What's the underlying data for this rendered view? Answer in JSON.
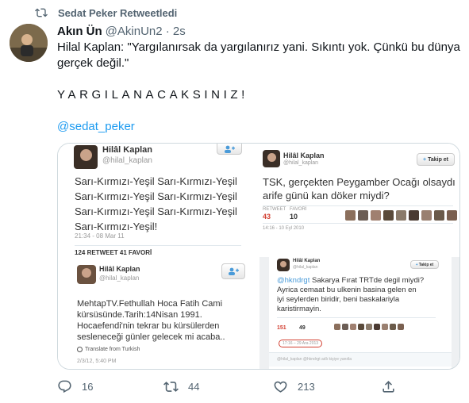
{
  "retweet": {
    "label": "Sedat Peker Retweetledi",
    "icon": "retweet-icon"
  },
  "author": {
    "name": "Akın Ün",
    "handle": "@AkinUn2 · 2s"
  },
  "tweet": {
    "text": "Hilal Kaplan: \"Yargılanırsak da yargılanırız yani. Sıkıntı yok. Çünkü bu dünya gerçek değil.\"",
    "shout": "YARGILANACAKSINIZ!",
    "mention": "@sedat_peker"
  },
  "media": {
    "img1": {
      "name": "Hilâl Kaplan",
      "handle": "@hilal_kaplan",
      "lines": [
        "Sarı-Kırmızı-Yeşil Sarı-Kırmızı-Yeşil",
        "Sarı-Kırmızı-Yeşil Sarı-Kırmızı-Yeşil",
        "Sarı-Kırmızı-Yeşil Sarı-Kırmızı-Yeşil",
        "Sarı-Kırmızı-Yeşil!"
      ],
      "time": "21:34 - 08 Mar 11",
      "stats": "124 RETWEET   41 FAVORİ"
    },
    "img2": {
      "name": "Hilâl Kaplan",
      "handle": "@hilal_kaplan",
      "follow": "Takip et",
      "lines": [
        "TSK, gerçekten Peygamber Ocağı olsaydı",
        "arife günü kan döker miydi?"
      ],
      "rt_label": "RETWEET",
      "rt_value": "43",
      "fav_label": "FAVORİ",
      "fav_value": "10",
      "time": "14:16 - 10 Eyl 2010"
    },
    "img3": {
      "name": "Hilâl Kaplan",
      "handle": "@hilal_kaplan",
      "lines": [
        "MehtapTV.Fethullah Hoca Fatih Cami",
        "kürsüsünde.Tarih:14Nisan 1991.",
        "Hocaefendi'nin tekrar bu kürsülerden",
        "sesleneceği günler gelecek mi acaba.."
      ],
      "translate": "Translate from Turkish",
      "time": "2/3/12, 5:40 PM"
    },
    "img4": {
      "name": "Hilâl Kaplan",
      "handle": "@hilal_kaplan",
      "follow": "Takip et",
      "lines": [
        "@hkndrgt Sakarya Fırat TRTde degil miydi?",
        "Ayrica cemaat bu ulkenin basina gelen en",
        "iyi seylerden biridir, beni baskalariyla",
        "karistirmayin."
      ],
      "rt_value": "151",
      "fav_value": "49",
      "time": "17:16 – 29 Ara 2013",
      "footer": "@hilal_kaplan @hkndrgt adlı kişiye yanıtla"
    }
  },
  "actions": {
    "reply": {
      "icon": "reply-icon",
      "count": "16"
    },
    "retweet": {
      "icon": "retweet-icon",
      "count": "44"
    },
    "like": {
      "icon": "heart-icon",
      "count": "213"
    },
    "share": {
      "icon": "share-icon"
    }
  },
  "colors": {
    "link": "#1d9bf0",
    "secondary": "#536471",
    "text": "#0f1419",
    "stat_red": "#d23f31"
  }
}
